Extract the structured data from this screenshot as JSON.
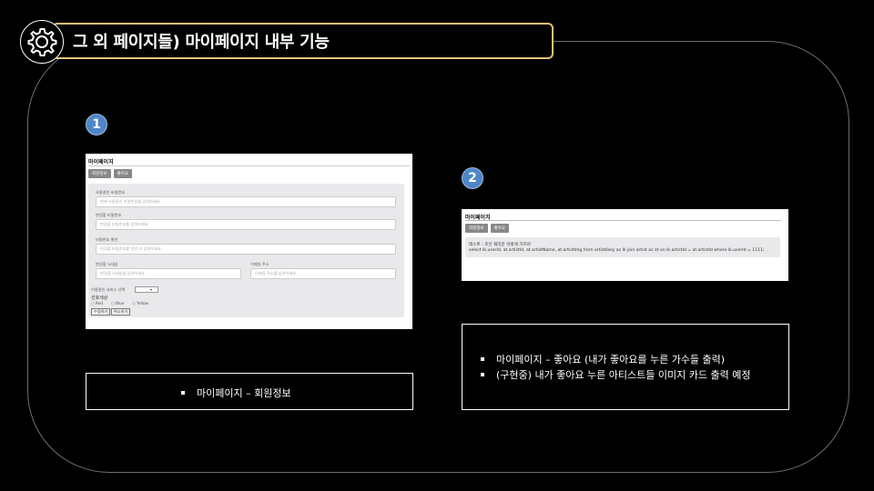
{
  "slide": {
    "title": "그 외 페이지들) 마이페이지 내부 기능"
  },
  "badges": [
    "1",
    "2"
  ],
  "shot1": {
    "page_title": "마이페이지",
    "tabs": [
      "회원정보",
      "좋아요"
    ],
    "fields": {
      "current_password_label": "사용중인 비밀번호",
      "current_password_placeholder": "현재 사용중인 비밀번호를 입력하세요",
      "new_password_label": "변경할 비밀번호",
      "new_password_placeholder": "변경할 비밀번호를 입력하세요",
      "confirm_password_label": "비밀번호 확인",
      "confirm_password_placeholder": "변경할 비밀번호를 한번 더 입력하세요",
      "nickname_label": "변경할 닉네임",
      "nickname_placeholder": "변경할 닉네임을 입력하세요",
      "email_label": "이메일 주소",
      "email_placeholder": "이메일 주소를 입력하세요",
      "service_label": "이용중인 서비스 선택",
      "preferred_color_label": "선호색상",
      "radio_options": [
        "Red",
        "Blue",
        "Yellow"
      ]
    },
    "buttons": {
      "submit": "수정하기",
      "cancel": "취소하기"
    }
  },
  "shot2": {
    "page_title": "마이페이지",
    "tabs": [
      "회원정보",
      "좋아요"
    ],
    "test_line": "테스트 : 조인 쿼리문 이렇게 가즈아",
    "query_line": "select lk.userId, at.artistId, at.artistName, at.artistImg from artistlikey as lk join artist as at on lk.artistId = at.artistId where lk.userId = 1111;"
  },
  "captions": {
    "caption1": [
      "마이페이지 – 회원정보"
    ],
    "caption2": [
      "마이페이지 – 좋아요 (내가 좋아요를 누른 가수들 출력)",
      "(구현중) 내가 좋아요 누른 아티스트들 이미지 카드 출력 예정"
    ]
  },
  "colors": {
    "accent_border": "#e8c27a",
    "badge": "#4f86c6",
    "frame": "#6e6e6e"
  }
}
